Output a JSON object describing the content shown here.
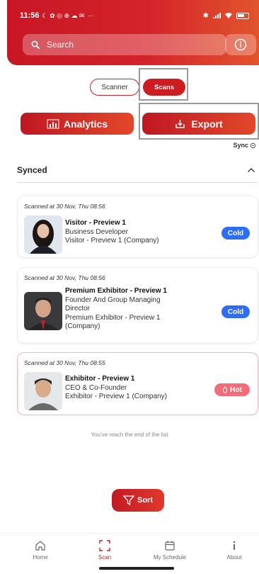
{
  "status_bar": {
    "time": "11:56",
    "extra": "··· "
  },
  "header": {
    "search_placeholder": "Search"
  },
  "toggle": {
    "scanner_label": "Scanner",
    "scans_label": "Scans"
  },
  "actions": {
    "analytics_label": "Analytics",
    "export_label": "Export"
  },
  "sync_label": "Sync",
  "section": {
    "title": "Synced"
  },
  "scans": [
    {
      "scanned_at": "Scanned at 30 Nov, Thu 08:56",
      "name": "Visitor - Preview 1",
      "lines": [
        "Business Developer",
        "Visitor - Preview 1 (Company)"
      ],
      "tag": "Cold"
    },
    {
      "scanned_at": "Scanned at 30 Nov, Thu 08:56",
      "name": "Premium Exhibitor - Preview 1",
      "lines": [
        "Founder And Group Managing",
        "Director",
        "Premium Exhibitor - Preview 1",
        "(Company)"
      ],
      "tag": "Cold"
    },
    {
      "scanned_at": "Scanned at 30 Nov, Thu 08:55",
      "name": "Exhibitor - Preview 1",
      "lines": [
        "CEO & Co-Founder",
        "Exhibitor - Preview 1 (Company)"
      ],
      "tag": "Hot"
    }
  ],
  "end_of_list": "You've reach the end of the list",
  "sort_label": "Sort",
  "nav": {
    "home": "Home",
    "scan": "Scan",
    "schedule": "My Schedule",
    "about": "About"
  },
  "colors": {
    "brand_red": "#cc1d23",
    "cold_blue": "#2d6ef5",
    "hot_pink": "#f26d78"
  },
  "icons": [
    "search-icon",
    "info-icon",
    "analytics-chart-icon",
    "export-download-icon",
    "sync-icon",
    "chevron-up-icon",
    "sort-filter-icon",
    "home-icon",
    "scan-icon",
    "schedule-icon",
    "about-info-icon",
    "fire-icon"
  ]
}
